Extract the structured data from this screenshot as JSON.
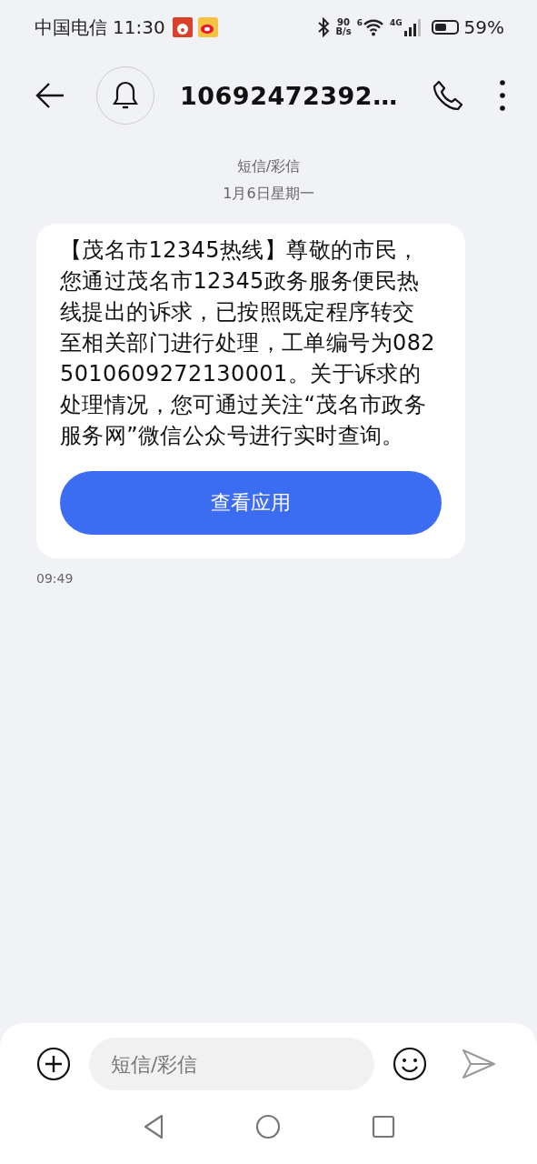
{
  "status_bar": {
    "carrier": "中国电信",
    "time": "11:30",
    "speed_value": "90",
    "speed_unit": "B/s",
    "wifi_label": "6",
    "cell_label": "4G",
    "battery": "59%"
  },
  "header": {
    "title": "10692472392…"
  },
  "thread": {
    "channel": "短信/彩信",
    "date": "1月6日星期一"
  },
  "messages": [
    {
      "text": "【茂名市12345热线】尊敬的市民，您通过茂名市12345政务服务便民热线提出的诉求，已按照既定程序转交至相关部门进行处理，工单编号为0825010609272130001。关于诉求的处理情况，您可通过关注“茂名市政务服务网”微信公众号进行实时查询。",
      "action": "查看应用",
      "time": "09:49"
    }
  ],
  "composer": {
    "placeholder": "短信/彩信"
  }
}
